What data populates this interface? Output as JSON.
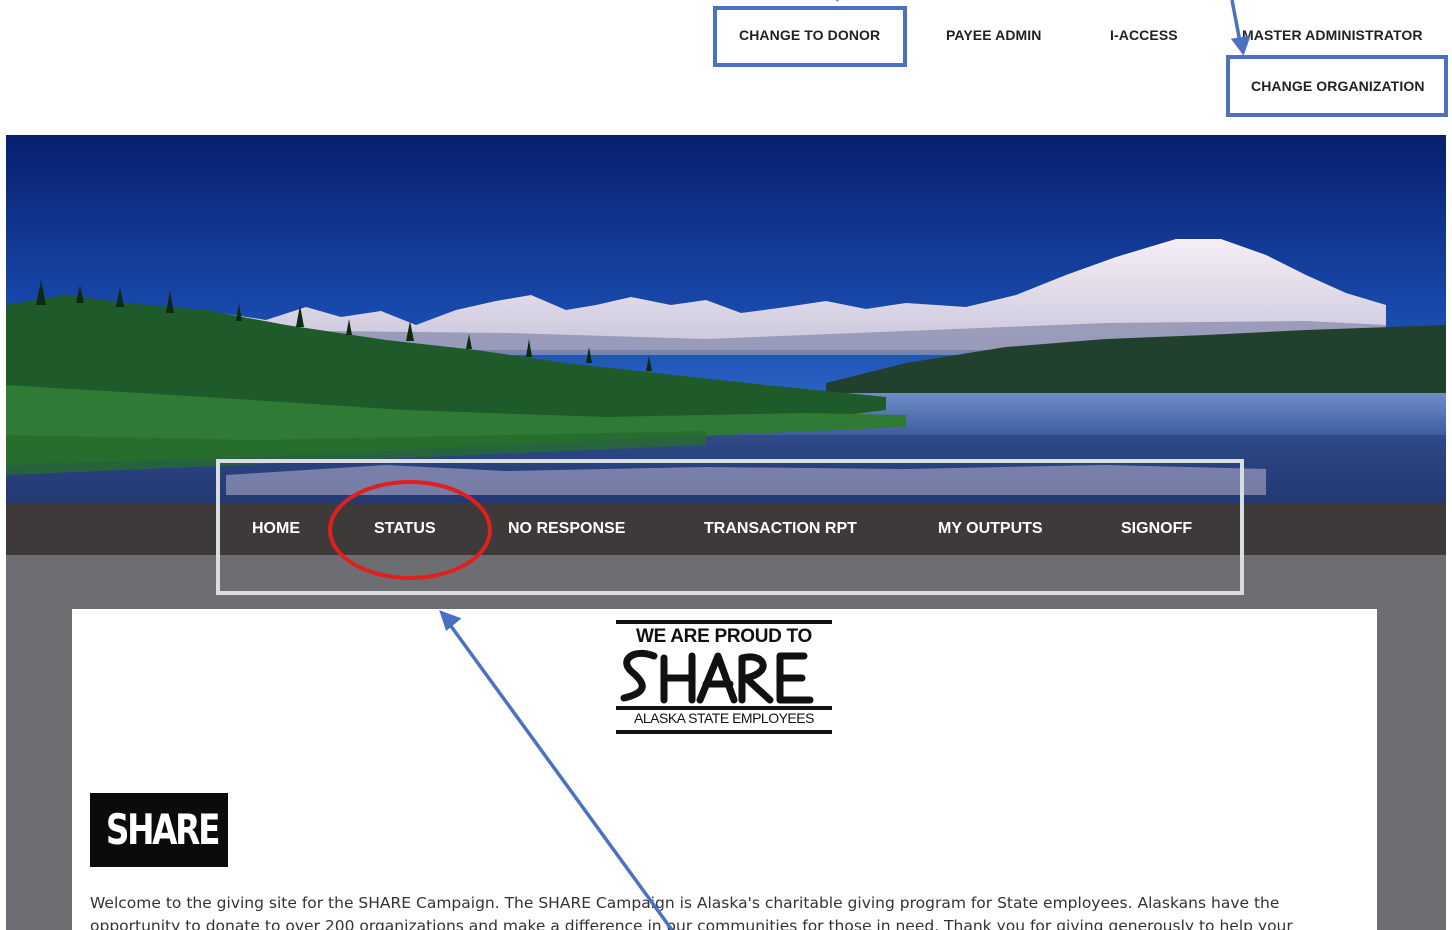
{
  "top_nav": {
    "change_to_donor": "CHANGE TO DONOR",
    "payee_admin": "PAYEE ADMIN",
    "i_access": "I-ACCESS",
    "master_administrator": "MASTER ADMINISTRATOR",
    "change_organization": "CHANGE ORGANIZATION"
  },
  "main_nav": {
    "items": [
      "HOME",
      "STATUS",
      "NO RESPONSE",
      "TRANSACTION RPT",
      "MY OUTPUTS",
      "SIGNOFF"
    ]
  },
  "logo": {
    "top_line": "WE ARE PROUD TO",
    "script_word": "SHARE",
    "bottom_line": "ALASKA STATE EMPLOYEES"
  },
  "content": {
    "heading": "SHARE",
    "welcome_text": "Welcome to the giving site for the SHARE Campaign. The SHARE Campaign is Alaska's charitable giving program for State employees. Alaskans have the opportunity to donate to over 200 organizations and make a difference in our communities for those in need. Thank you for giving generously to help your"
  },
  "colors": {
    "annotation_blue": "#4a72c0",
    "annotation_red": "#e0201c",
    "nav_bar": "#3e3a39",
    "content_gray": "#6d6e72"
  }
}
